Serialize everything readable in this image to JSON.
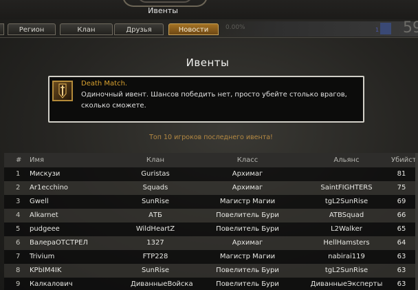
{
  "header": {
    "title": "Ивенты"
  },
  "tabs": [
    {
      "label": "Регион",
      "active": false
    },
    {
      "label": "Клан",
      "active": false
    },
    {
      "label": "Друзья",
      "active": false
    },
    {
      "label": "Новости",
      "active": true
    }
  ],
  "hud": {
    "percent": "0.00%",
    "level_small": "1",
    "level_large": "59"
  },
  "section_title": "Ивенты",
  "event": {
    "name": "Death Match.",
    "description": "Одиночный ивент. Шансов победить нет, просто убейте столько врагов, сколько сможете.",
    "icon": "sword-banner-icon"
  },
  "top_caption": "Топ 10 игроков последнего ивента!",
  "table": {
    "columns": [
      "#",
      "Имя",
      "Клан",
      "Класс",
      "Альянс",
      "Убийств"
    ],
    "rows": [
      {
        "rank": "1",
        "name": "Мискузи",
        "clan": "Guristas",
        "class": "Архимаг",
        "alliance": "",
        "kills": "81"
      },
      {
        "rank": "2",
        "name": "Ar1ecchino",
        "clan": "Squads",
        "class": "Архимаг",
        "alliance": "SaintFIGHTERS",
        "kills": "75"
      },
      {
        "rank": "3",
        "name": "Gwell",
        "clan": "SunRise",
        "class": "Магистр Магии",
        "alliance": "tgL2SunRise",
        "kills": "69"
      },
      {
        "rank": "4",
        "name": "Alkarnet",
        "clan": "АТБ",
        "class": "Повелитель Бури",
        "alliance": "ATBSquad",
        "kills": "66"
      },
      {
        "rank": "5",
        "name": "pudgeee",
        "clan": "WildHeartZ",
        "class": "Повелитель Бури",
        "alliance": "L2Walker",
        "kills": "65"
      },
      {
        "rank": "6",
        "name": "ВалераОТСТРЕЛ",
        "clan": "1327",
        "class": "Архимаг",
        "alliance": "HellHamsters",
        "kills": "64"
      },
      {
        "rank": "7",
        "name": "Trivium",
        "clan": "FTP228",
        "class": "Магистр Магии",
        "alliance": "nabirai119",
        "kills": "63"
      },
      {
        "rank": "8",
        "name": "KPbIM4IK",
        "clan": "SunRise",
        "class": "Повелитель Бури",
        "alliance": "tgL2SunRise",
        "kills": "63"
      },
      {
        "rank": "9",
        "name": "Калкалович",
        "clan": "ДиванныеВойска",
        "class": "Повелитель Бури",
        "alliance": "ДиванныеЭксперты",
        "kills": "63"
      }
    ]
  },
  "colors": {
    "accent": "#d8a12f",
    "active_tab": "#a47224",
    "caption": "#b68a43"
  }
}
